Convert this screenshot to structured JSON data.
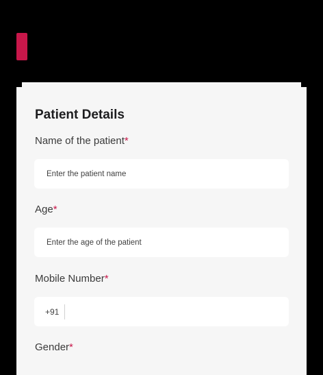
{
  "colors": {
    "accent": "#c8174a",
    "card_background": "#f6f6f6",
    "page_background": "#000000"
  },
  "form": {
    "title": "Patient Details",
    "required_marker": "*",
    "fields": {
      "patient_name": {
        "label": "Name of the patient",
        "placeholder": "Enter the patient name",
        "value": ""
      },
      "age": {
        "label": "Age",
        "placeholder": "Enter the age of the patient",
        "value": ""
      },
      "mobile": {
        "label": "Mobile Number",
        "prefix": "+91",
        "value": ""
      },
      "gender": {
        "label": "Gender"
      }
    }
  }
}
